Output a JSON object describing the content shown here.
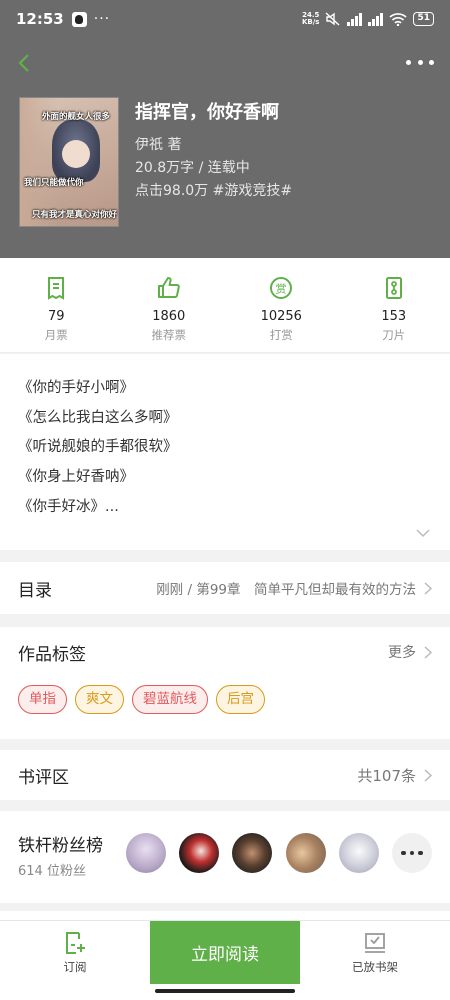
{
  "status_bar": {
    "time": "12:53",
    "dots": "···",
    "net_speed_value": "24.5",
    "net_speed_unit": "KB/s",
    "battery": "51"
  },
  "book": {
    "title": "指挥官，你好香啊",
    "author": "伊祇 著",
    "words_status": "20.8万字 / 连载中",
    "clicks_genre": "点击98.0万 #游戏竞技#",
    "cover_captions": [
      "外面的舰女人很多",
      "我们只能做代你",
      "只有我才是真心对你好"
    ]
  },
  "stats": [
    {
      "icon": "monthly-ticket-icon",
      "value": "79",
      "label": "月票"
    },
    {
      "icon": "thumbs-up-icon",
      "value": "1860",
      "label": "推荐票"
    },
    {
      "icon": "reward-icon",
      "value": "10256",
      "label": "打赏"
    },
    {
      "icon": "blade-icon",
      "value": "153",
      "label": "刀片"
    }
  ],
  "intro": {
    "lines": [
      "《你的手好小啊》",
      "《怎么比我白这么多啊》",
      "《听说舰娘的手都很软》",
      "《你身上好香呐》",
      "《你手好冰》..."
    ]
  },
  "toc": {
    "title": "目录",
    "latest": "刚刚 / 第99章　简单平凡但却最有效的方法"
  },
  "tags_section": {
    "title": "作品标签",
    "more": "更多",
    "tags": [
      {
        "label": "单指",
        "color": "#e25a5a",
        "bg": "#fdeeee"
      },
      {
        "label": "爽文",
        "color": "#d99a1c",
        "bg": "#fdf5e2"
      },
      {
        "label": "碧蓝航线",
        "color": "#e25a5a",
        "bg": "#fdeeee"
      },
      {
        "label": "后宫",
        "color": "#d99a1c",
        "bg": "#fdf5e2"
      }
    ]
  },
  "review": {
    "title": "书评区",
    "count": "共107条"
  },
  "fans": {
    "title": "铁杆粉丝榜",
    "count": "614 位粉丝"
  },
  "bottom_bar": {
    "subscribe": "订阅",
    "read_now": "立即阅读",
    "shelf": "已放书架"
  },
  "colors": {
    "accent": "#5fb049",
    "header_bg": "#6b6b6b"
  }
}
